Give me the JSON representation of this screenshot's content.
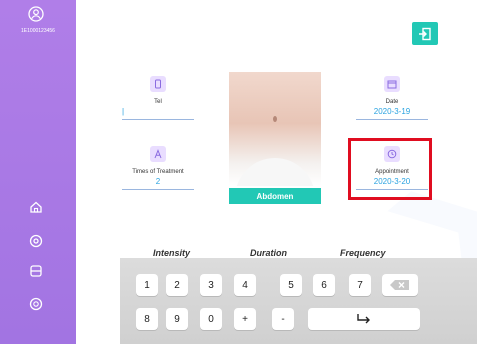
{
  "sidebar": {
    "user_id": "1E1000123456",
    "icons": [
      "home-icon",
      "settings-icon",
      "save-icon",
      "palette-icon"
    ]
  },
  "header": {
    "exit_icon": "logout-icon"
  },
  "fields": {
    "tel": {
      "label": "Tel",
      "value": "|"
    },
    "date": {
      "label": "Date",
      "value": "2020-3-19"
    },
    "times": {
      "label": "Times of Treatment",
      "value": "2"
    },
    "appointment": {
      "label": "Appointment",
      "value": "2020-3-20"
    }
  },
  "body_area": {
    "label": "Abdomen"
  },
  "params": {
    "intensity": "Intensity",
    "duration": "Duration",
    "frequency": "Frequency"
  },
  "keyboard": {
    "row1": [
      "1",
      "2",
      "3",
      "4",
      "5",
      "6",
      "7"
    ],
    "row2": [
      "8",
      "9",
      "0",
      "+",
      "-"
    ],
    "enter_icon": "enter-icon",
    "backspace_icon": "backspace-icon"
  },
  "colors": {
    "sidebar": "#a97ae6",
    "accent": "#22c8b5",
    "value": "#2aa3e0",
    "highlight": "#e00d20"
  }
}
